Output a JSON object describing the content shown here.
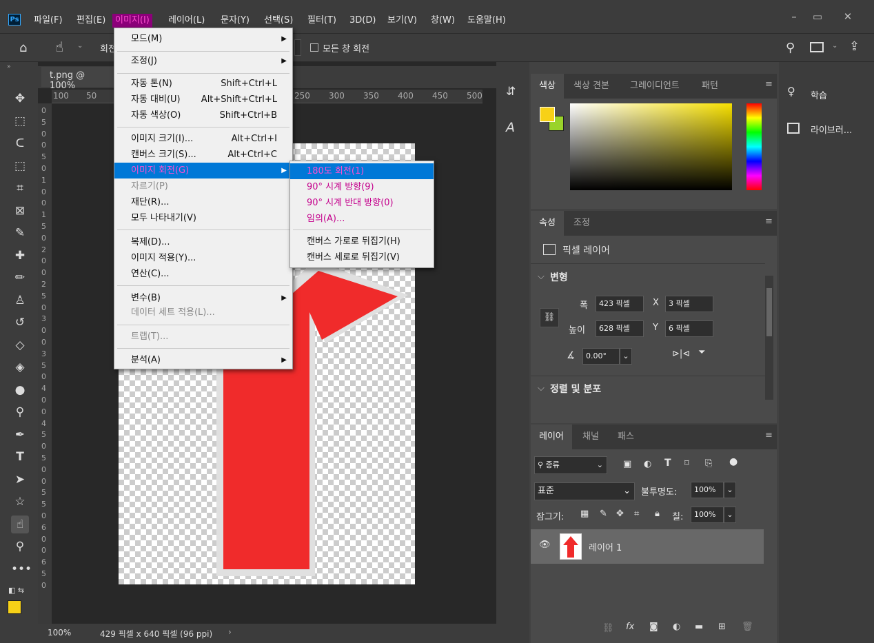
{
  "app": {
    "icon_text": "Ps"
  },
  "menubar": [
    "파일(F)",
    "편집(E)",
    "이미지(I)",
    "레이어(L)",
    "문자(Y)",
    "선택(S)",
    "필터(T)",
    "3D(D)",
    "보기(V)",
    "창(W)",
    "도움말(H)"
  ],
  "options_bar": {
    "rotate_label": "회전",
    "rotate_all_windows": "모든 창 회전"
  },
  "document": {
    "tab_title": "t.png @ 100%",
    "zoom": "100%",
    "size_info": "429 픽셀 x 640 픽셀 (96 ppi)"
  },
  "ruler": {
    "h_ticks": [
      "100",
      "50",
      "250",
      "300",
      "350",
      "400",
      "450",
      "500"
    ],
    "v_ticks": [
      "0",
      "5",
      "0",
      "0",
      "5",
      "0",
      "1",
      "0",
      "0",
      "1",
      "5",
      "0",
      "2",
      "0",
      "0",
      "2",
      "5",
      "0",
      "3",
      "0",
      "0",
      "3",
      "5",
      "0",
      "4",
      "0",
      "0",
      "4",
      "5",
      "0",
      "5",
      "0",
      "0",
      "5",
      "5",
      "0",
      "6",
      "0",
      "0",
      "6",
      "5",
      "0"
    ]
  },
  "image_menu": {
    "items": [
      {
        "label": "모드(M)",
        "submenu": true
      },
      {
        "label": "조정(J)",
        "submenu": true
      },
      {
        "label": "자동 톤(N)",
        "shortcut": "Shift+Ctrl+L"
      },
      {
        "label": "자동 대비(U)",
        "shortcut": "Alt+Shift+Ctrl+L"
      },
      {
        "label": "자동 색상(O)",
        "shortcut": "Shift+Ctrl+B"
      },
      {
        "label": "이미지 크기(I)...",
        "shortcut": "Alt+Ctrl+I"
      },
      {
        "label": "캔버스 크기(S)...",
        "shortcut": "Alt+Ctrl+C"
      },
      {
        "label": "이미지 회전(G)",
        "submenu": true
      },
      {
        "label": "자르기(P)"
      },
      {
        "label": "재단(R)..."
      },
      {
        "label": "모두 나타내기(V)"
      },
      {
        "label": "복제(D)..."
      },
      {
        "label": "이미지 적용(Y)..."
      },
      {
        "label": "연산(C)..."
      },
      {
        "label": "변수(B)",
        "submenu": true
      },
      {
        "label": "데이터 세트 적용(L)..."
      },
      {
        "label": "트랩(T)..."
      },
      {
        "label": "분석(A)",
        "submenu": true
      }
    ]
  },
  "rotate_submenu": {
    "items": [
      "180도 회전(1)",
      "90° 시계 방향(9)",
      "90° 시계 반대 방향(0)",
      "임의(A)...",
      "캔버스 가로로 뒤집기(H)",
      "캔버스 세로로 뒤집기(V)"
    ]
  },
  "color_panel": {
    "tabs": [
      "색상",
      "색상 견본",
      "그레이디언트",
      "패턴"
    ],
    "foreground": "#f7d117",
    "background": "#9ad32a"
  },
  "properties_panel": {
    "tabs": [
      "속성",
      "조정"
    ],
    "layer_type": "픽셀 레이어",
    "transform_title": "변형",
    "width_label": "폭",
    "width_value": "423 픽셀",
    "height_label": "높이",
    "height_value": "628 픽셀",
    "x_label": "X",
    "x_value": "3 픽셀",
    "y_label": "Y",
    "y_value": "6 픽셀",
    "angle_value": "0.00°",
    "align_title": "정렬 및 분포"
  },
  "layers_panel": {
    "tabs": [
      "레이어",
      "채널",
      "패스"
    ],
    "filter_kind": "종류",
    "blend_mode": "표준",
    "opacity_label": "불투명도:",
    "opacity_value": "100%",
    "lock_label": "잠그기:",
    "fill_label": "칠:",
    "fill_value": "100%",
    "layers": [
      {
        "name": "레이어 1"
      }
    ]
  },
  "side_panels": [
    "학습",
    "라이브러..."
  ]
}
